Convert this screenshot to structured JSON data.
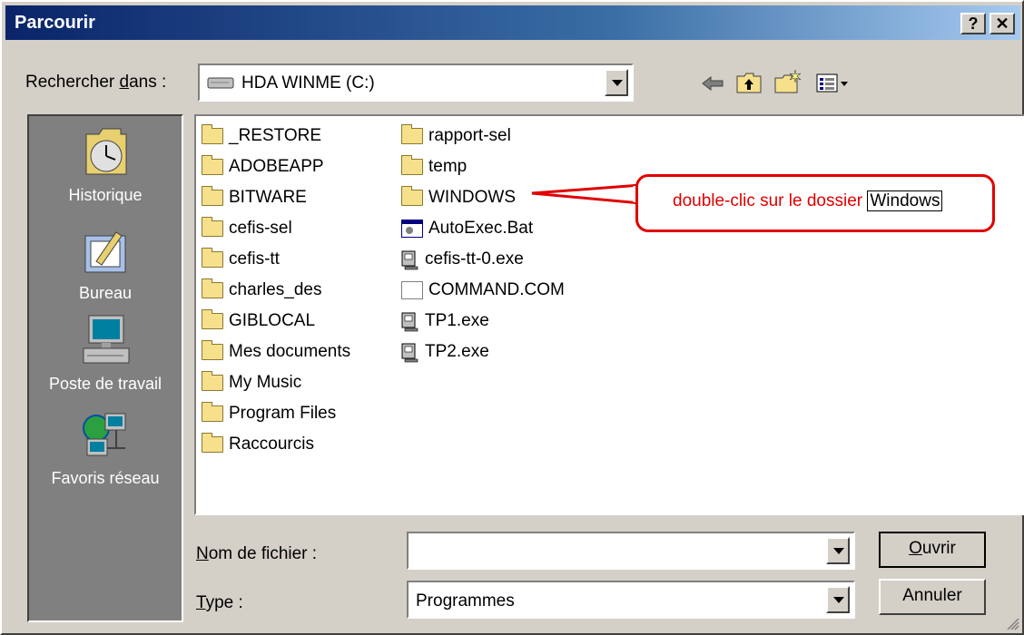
{
  "title": "Parcourir",
  "titlebar_buttons": {
    "help": "?",
    "close": "✕"
  },
  "lookin": {
    "label_pre": "Rechercher ",
    "label_ul": "d",
    "label_post": "ans :",
    "value": "HDA WINME (C:)"
  },
  "places": [
    {
      "label": "Historique",
      "icon": "history-icon"
    },
    {
      "label": "Bureau",
      "icon": "desktop-icon"
    },
    {
      "label": "Poste de travail",
      "icon": "computer-icon"
    },
    {
      "label": "Favoris réseau",
      "icon": "network-icon"
    }
  ],
  "files_col1": [
    "_RESTORE",
    "ADOBEAPP",
    "BITWARE",
    "cefis-sel",
    "cefis-tt",
    "charles_des",
    "GIBLOCAL",
    "Mes documents",
    "My Music",
    "Program Files",
    "Raccourcis"
  ],
  "files_col2": [
    {
      "name": "rapport-sel",
      "type": "folder"
    },
    {
      "name": "temp",
      "type": "folder"
    },
    {
      "name": "WINDOWS",
      "type": "folder"
    },
    {
      "name": "AutoExec.Bat",
      "type": "bat"
    },
    {
      "name": "cefis-tt-0.exe",
      "type": "exe"
    },
    {
      "name": "COMMAND.COM",
      "type": "com"
    },
    {
      "name": "TP1.exe",
      "type": "exe"
    },
    {
      "name": "TP2.exe",
      "type": "exe"
    }
  ],
  "filename": {
    "label_ul": "N",
    "label_post": "om de fichier :",
    "value": ""
  },
  "filetype": {
    "label_ul": "T",
    "label_post": "ype :",
    "value": "Programmes"
  },
  "buttons": {
    "open_ul": "O",
    "open_post": "uvrir",
    "cancel": "Annuler"
  },
  "annotation": {
    "text": "double-clic sur le dossier ",
    "boxed": "Windows"
  },
  "colors": {
    "annotation": "#e00000",
    "titlebar_start": "#0a246a",
    "titlebar_end": "#a6caf0"
  }
}
